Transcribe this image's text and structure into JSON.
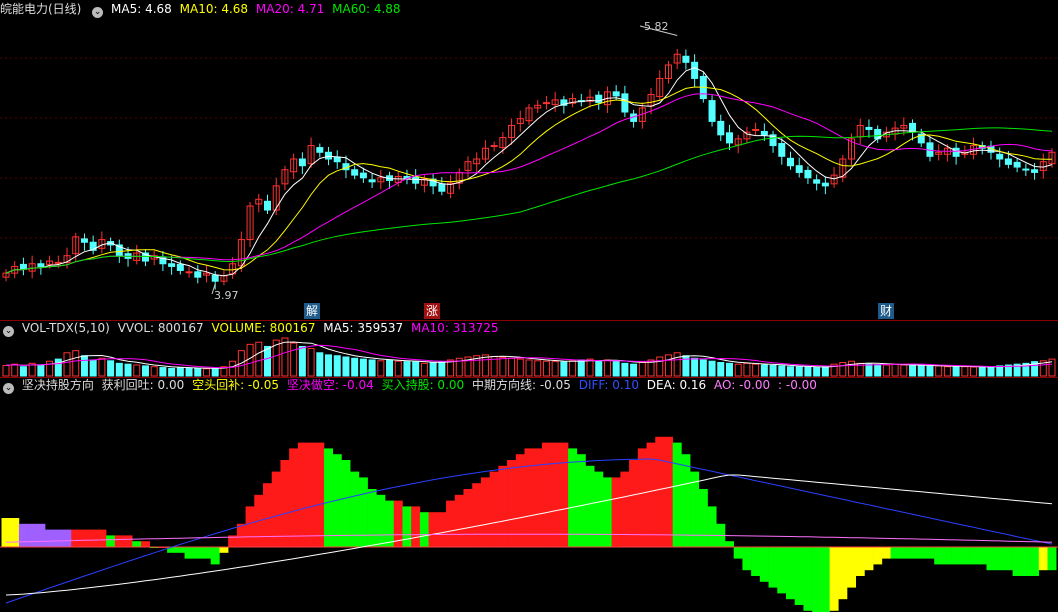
{
  "price_legend": {
    "stock_name": "皖能电力(日线)",
    "ma5": "MA5: 4.68",
    "ma10": "MA10: 4.68",
    "ma20": "MA20: 4.71",
    "ma60": "MA60: 4.88"
  },
  "price_annotations": {
    "high": "5.82",
    "low": "3.97"
  },
  "event_tags": [
    "解",
    "涨",
    "财"
  ],
  "vol_legend": {
    "name": "VOL-TDX(5,10)",
    "vvol": "VVOL: 800167",
    "volume": "VOLUME: 800167",
    "ma5": "MA5: 359537",
    "ma10": "MA10: 313725"
  },
  "ind_legend": {
    "name": "坚决持股方向",
    "profit": "获利回吐: 0.00",
    "short_back": "空头回补: -0.05",
    "short_firm": "坚决做空: -0.04",
    "buy_hold": "买入持股: 0.00",
    "mid_dir": "中期方向线: -0.05",
    "diff": "DIFF: 0.10",
    "dea": "DEA: 0.16",
    "ao": "AO: -0.00",
    "last": ": -0.00"
  },
  "colors": {
    "up": "#ff3232",
    "down": "#54ffff",
    "ma5": "#ffffff",
    "ma10": "#ffff00",
    "ma20": "#ff00ff",
    "ma60": "#00e600",
    "frame": "#8b0000"
  },
  "chart_data": {
    "type": "candlestick",
    "price_range": [
      3.97,
      5.82
    ],
    "close": [
      4.05,
      4.1,
      4.08,
      4.12,
      4.1,
      4.14,
      4.13,
      4.18,
      4.32,
      4.28,
      4.22,
      4.3,
      4.26,
      4.18,
      4.16,
      4.2,
      4.14,
      4.18,
      4.12,
      4.1,
      4.07,
      4.06,
      4.02,
      4.05,
      3.99,
      4.03,
      4.12,
      4.3,
      4.55,
      4.6,
      4.52,
      4.7,
      4.82,
      4.9,
      4.85,
      5.0,
      4.95,
      4.9,
      4.88,
      4.82,
      4.78,
      4.76,
      4.73,
      4.76,
      4.74,
      4.77,
      4.75,
      4.72,
      4.75,
      4.7,
      4.66,
      4.72,
      4.8,
      4.88,
      4.9,
      4.98,
      5.0,
      5.06,
      5.15,
      5.2,
      5.28,
      5.3,
      5.32,
      5.34,
      5.3,
      5.35,
      5.33,
      5.36,
      5.32,
      5.4,
      5.37,
      5.25,
      5.18,
      5.28,
      5.38,
      5.5,
      5.6,
      5.68,
      5.62,
      5.5,
      5.35,
      5.18,
      5.08,
      5.02,
      5.05,
      5.1,
      5.12,
      5.08,
      5.0,
      4.92,
      4.85,
      4.8,
      4.76,
      4.72,
      4.7,
      4.78,
      4.9,
      5.05,
      5.15,
      5.12,
      5.05,
      5.1,
      5.13,
      5.15,
      5.1,
      5.02,
      4.92,
      4.95,
      4.98,
      4.92,
      4.95,
      5.0,
      4.98,
      4.95,
      4.9,
      4.86,
      4.84,
      4.82,
      4.8,
      4.88,
      4.95
    ],
    "volume": [
      25,
      28,
      22,
      30,
      26,
      35,
      40,
      55,
      60,
      48,
      38,
      42,
      36,
      30,
      28,
      26,
      24,
      22,
      20,
      18,
      20,
      19,
      18,
      17,
      18,
      22,
      35,
      60,
      75,
      80,
      70,
      85,
      90,
      78,
      70,
      65,
      55,
      50,
      48,
      45,
      42,
      40,
      38,
      36,
      38,
      35,
      34,
      33,
      30,
      32,
      34,
      38,
      42,
      45,
      48,
      50,
      46,
      44,
      42,
      40,
      38,
      36,
      35,
      34,
      33,
      36,
      38,
      40,
      35,
      38,
      36,
      30,
      28,
      32,
      38,
      45,
      50,
      55,
      48,
      42,
      38,
      35,
      32,
      30,
      28,
      30,
      28,
      26,
      25,
      24,
      22,
      22,
      21,
      20,
      22,
      28,
      32,
      35,
      30,
      28,
      27,
      26,
      28,
      26,
      25,
      24,
      23,
      24,
      22,
      23,
      22,
      21,
      20,
      22,
      24,
      26,
      28,
      30,
      34,
      36,
      40
    ],
    "macd_bar": [
      0.05,
      0.05,
      0.04,
      0.04,
      0.04,
      0.03,
      0.03,
      0.03,
      0.03,
      0.03,
      0.03,
      0.03,
      0.02,
      0.02,
      0.02,
      0.01,
      0.01,
      0.0,
      0.0,
      -0.01,
      -0.01,
      -0.02,
      -0.02,
      -0.02,
      -0.03,
      -0.01,
      0.02,
      0.04,
      0.07,
      0.09,
      0.11,
      0.13,
      0.15,
      0.17,
      0.18,
      0.18,
      0.18,
      0.17,
      0.16,
      0.15,
      0.13,
      0.12,
      0.1,
      0.09,
      0.08,
      0.08,
      0.07,
      0.07,
      0.06,
      0.06,
      0.06,
      0.08,
      0.09,
      0.1,
      0.11,
      0.12,
      0.13,
      0.14,
      0.15,
      0.16,
      0.17,
      0.17,
      0.18,
      0.18,
      0.18,
      0.17,
      0.16,
      0.14,
      0.13,
      0.12,
      0.12,
      0.13,
      0.15,
      0.17,
      0.18,
      0.19,
      0.19,
      0.18,
      0.16,
      0.13,
      0.1,
      0.07,
      0.04,
      0.01,
      -0.02,
      -0.04,
      -0.05,
      -0.06,
      -0.07,
      -0.08,
      -0.09,
      -0.1,
      -0.11,
      -0.12,
      -0.12,
      -0.11,
      -0.09,
      -0.07,
      -0.05,
      -0.04,
      -0.03,
      -0.02,
      -0.02,
      -0.02,
      -0.02,
      -0.02,
      -0.02,
      -0.03,
      -0.03,
      -0.03,
      -0.03,
      -0.03,
      -0.03,
      -0.04,
      -0.04,
      -0.04,
      -0.05,
      -0.05,
      -0.05,
      -0.04,
      -0.04
    ]
  }
}
